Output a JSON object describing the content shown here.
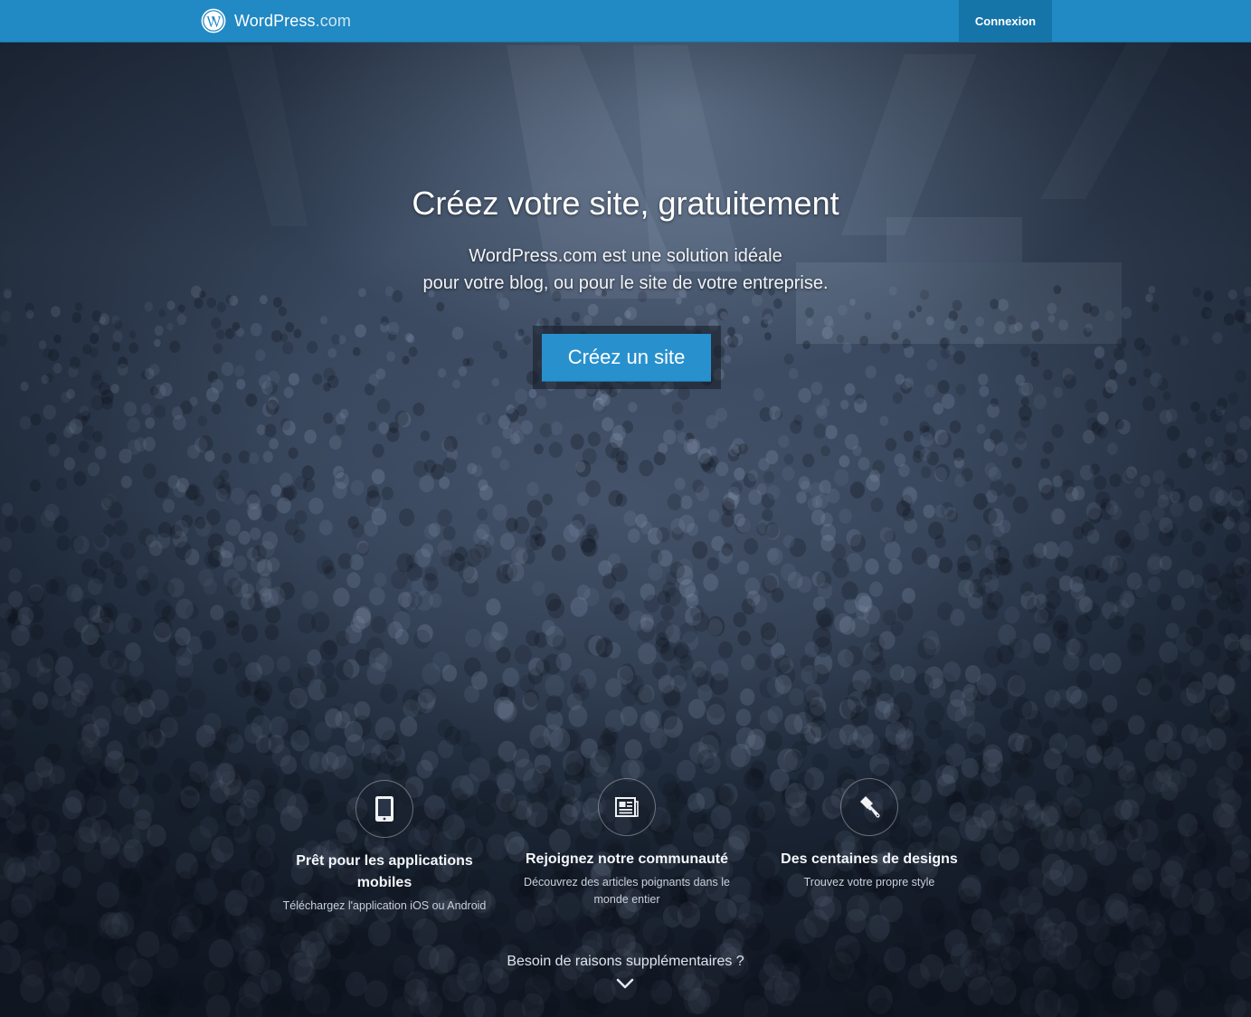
{
  "header": {
    "brand_name": "WordPress",
    "brand_suffix": ".com",
    "login_label": "Connexion",
    "bar_color": "#2189c3"
  },
  "hero": {
    "headline": "Créez votre site, gratuitement",
    "subline_1": "WordPress.com est une solution idéale",
    "subline_2": "pour votre blog, ou pour le site de votre entreprise.",
    "cta_label": "Créez un site",
    "cta_color": "#2891cd"
  },
  "features": [
    {
      "icon": "tablet-icon",
      "title": "Prêt pour les applications mobiles",
      "description": "Téléchargez l'application iOS ou Android"
    },
    {
      "icon": "newspaper-icon",
      "title": "Rejoignez notre communauté",
      "description": "Découvrez des articles poignants dans le monde entier"
    },
    {
      "icon": "paintbrush-icon",
      "title": "Des centaines de designs",
      "description": "Trouvez votre propre style"
    }
  ],
  "more": {
    "label": "Besoin de raisons supplémentaires ?",
    "icon": "chevron-down-icon"
  }
}
